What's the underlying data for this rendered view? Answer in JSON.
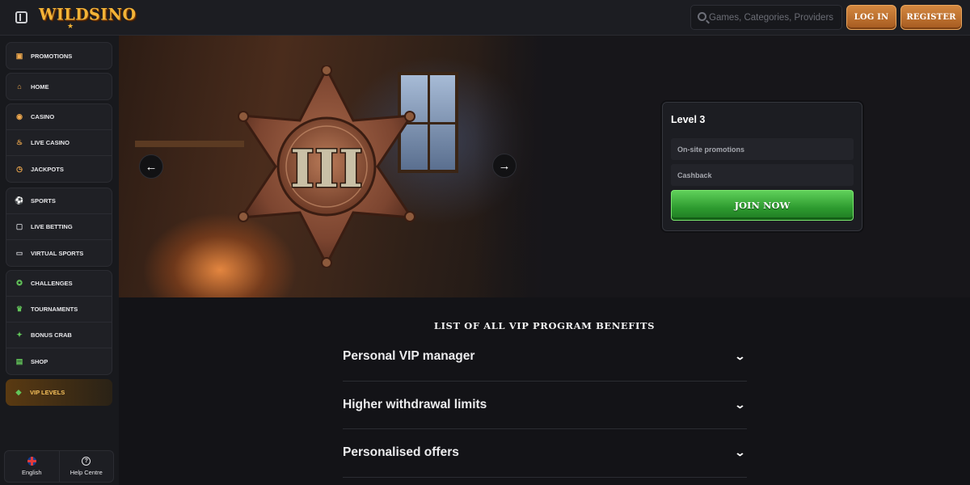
{
  "header": {
    "logo_text": "WILDSINO",
    "search_placeholder": "Games, Categories, Providers",
    "login_label": "LOG IN",
    "register_label": "REGISTER"
  },
  "sidebar": {
    "groups": [
      [
        {
          "label": "PROMOTIONS",
          "icon": "gift-icon"
        }
      ],
      [
        {
          "label": "HOME",
          "icon": "home-icon"
        }
      ],
      [
        {
          "label": "CASINO",
          "icon": "chip-icon"
        },
        {
          "label": "LIVE CASINO",
          "icon": "flame-icon"
        },
        {
          "label": "JACKPOTS",
          "icon": "clock-icon"
        }
      ],
      [
        {
          "label": "SPORTS",
          "icon": "ball-icon"
        },
        {
          "label": "LIVE BETTING",
          "icon": "live-icon"
        },
        {
          "label": "VIRTUAL SPORTS",
          "icon": "gamepad-icon"
        }
      ],
      [
        {
          "label": "CHALLENGES",
          "icon": "medal-icon"
        },
        {
          "label": "TOURNAMENTS",
          "icon": "trophy-icon"
        },
        {
          "label": "BONUS CRAB",
          "icon": "crab-icon"
        },
        {
          "label": "SHOP",
          "icon": "shop-icon"
        }
      ]
    ],
    "active_item": {
      "label": "VIP LEVELS",
      "icon": "diamond-icon"
    },
    "footer": {
      "language_label": "English",
      "help_label": "Help Centre"
    }
  },
  "hero": {
    "badge_numeral": "III",
    "level_card": {
      "title": "Level 3",
      "rows": [
        "On-site promotions",
        "Cashback"
      ],
      "cta_label": "JOIN NOW"
    }
  },
  "benefits": {
    "title": "LIST OF ALL VIP PROGRAM BENEFITS",
    "items": [
      "Personal VIP manager",
      "Higher withdrawal limits",
      "Personalised offers"
    ]
  },
  "colors": {
    "accent_orange": "#d48840",
    "cta_green": "#2d9a2f",
    "active_vip_text": "#f6c15b"
  }
}
